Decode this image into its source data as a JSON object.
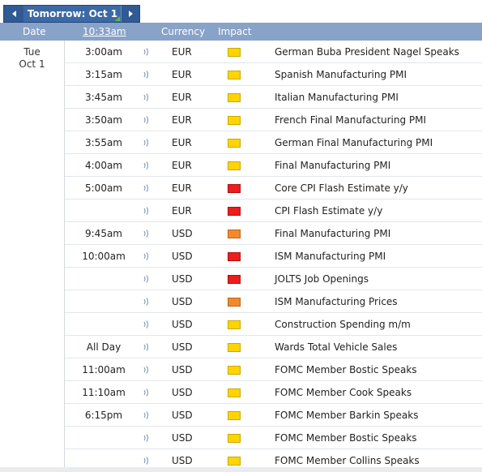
{
  "nav": {
    "title": "Tomorrow: Oct 1"
  },
  "header": {
    "date": "Date",
    "time": "10:33am",
    "currency": "Currency",
    "impact": "Impact"
  },
  "day": {
    "weekday": "Tue",
    "date": "Oct 1"
  },
  "impact_colors": {
    "low": "#ffd400",
    "medium": "#f08a2c",
    "high": "#ec1d1d"
  },
  "rows": [
    {
      "time": "3:00am",
      "currency": "EUR",
      "impact": "low",
      "event": "German Buba President Nagel Speaks"
    },
    {
      "time": "3:15am",
      "currency": "EUR",
      "impact": "low",
      "event": "Spanish Manufacturing PMI"
    },
    {
      "time": "3:45am",
      "currency": "EUR",
      "impact": "low",
      "event": "Italian Manufacturing PMI"
    },
    {
      "time": "3:50am",
      "currency": "EUR",
      "impact": "low",
      "event": "French Final Manufacturing PMI"
    },
    {
      "time": "3:55am",
      "currency": "EUR",
      "impact": "low",
      "event": "German Final Manufacturing PMI"
    },
    {
      "time": "4:00am",
      "currency": "EUR",
      "impact": "low",
      "event": "Final Manufacturing PMI"
    },
    {
      "time": "5:00am",
      "currency": "EUR",
      "impact": "high",
      "event": "Core CPI Flash Estimate y/y"
    },
    {
      "time": "",
      "currency": "EUR",
      "impact": "high",
      "event": "CPI Flash Estimate y/y"
    },
    {
      "time": "9:45am",
      "currency": "USD",
      "impact": "medium",
      "event": "Final Manufacturing PMI"
    },
    {
      "time": "10:00am",
      "currency": "USD",
      "impact": "high",
      "event": "ISM Manufacturing PMI"
    },
    {
      "time": "",
      "currency": "USD",
      "impact": "high",
      "event": "JOLTS Job Openings"
    },
    {
      "time": "",
      "currency": "USD",
      "impact": "medium",
      "event": "ISM Manufacturing Prices"
    },
    {
      "time": "",
      "currency": "USD",
      "impact": "low",
      "event": "Construction Spending m/m"
    },
    {
      "time": "All Day",
      "currency": "USD",
      "impact": "low",
      "event": "Wards Total Vehicle Sales"
    },
    {
      "time": "11:00am",
      "currency": "USD",
      "impact": "low",
      "event": "FOMC Member Bostic Speaks"
    },
    {
      "time": "11:10am",
      "currency": "USD",
      "impact": "low",
      "event": "FOMC Member Cook Speaks"
    },
    {
      "time": "6:15pm",
      "currency": "USD",
      "impact": "low",
      "event": "FOMC Member Barkin Speaks"
    },
    {
      "time": "",
      "currency": "USD",
      "impact": "low",
      "event": "FOMC Member Bostic Speaks"
    },
    {
      "time": "",
      "currency": "USD",
      "impact": "low",
      "event": "FOMC Member Collins Speaks"
    }
  ]
}
